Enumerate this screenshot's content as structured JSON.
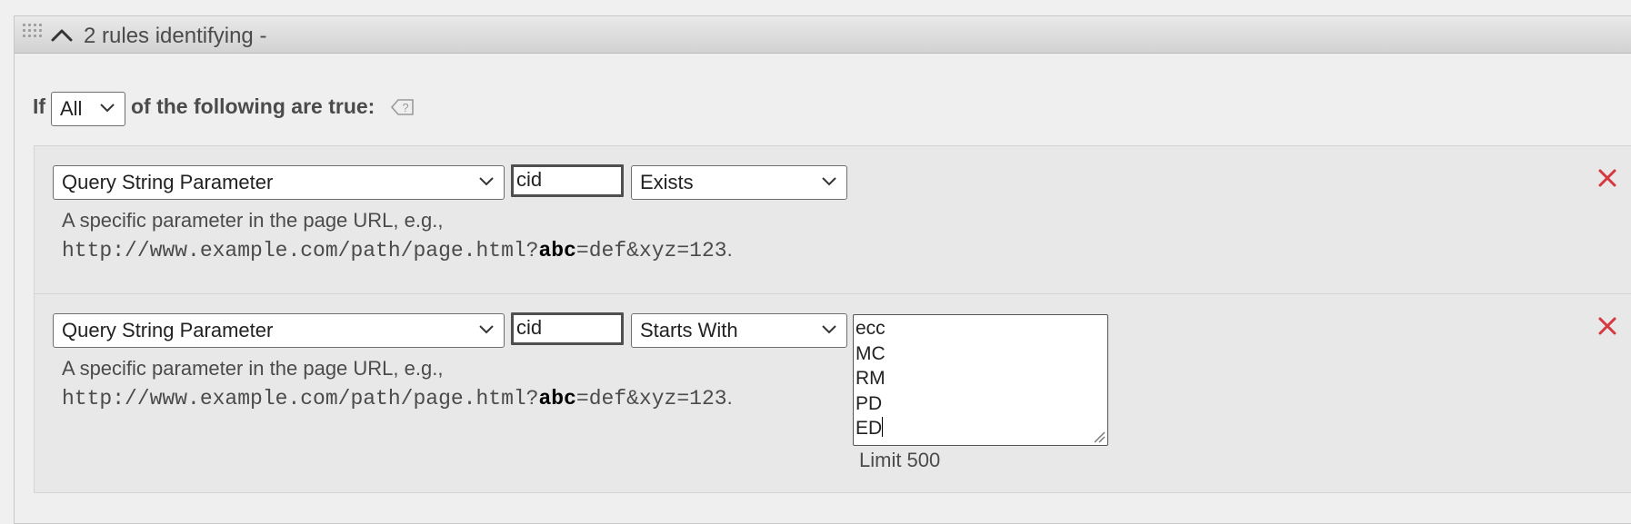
{
  "header": {
    "title": "2 rules identifying -"
  },
  "condition": {
    "if_label": "If",
    "match_value": "All",
    "suffix": "of the following are true:"
  },
  "rules": [
    {
      "type_value": "Query String Parameter",
      "param_value": "cid",
      "operator_value": "Exists",
      "description": "A specific parameter in the page URL, e.g.,",
      "example_prefix": "http://www.example.com/path/page.html?",
      "example_bold": "abc",
      "example_suffix": "=def&xyz=123",
      "example_end": "."
    },
    {
      "type_value": "Query String Parameter",
      "param_value": "cid",
      "operator_value": "Starts With",
      "description": "A specific parameter in the page URL, e.g.,",
      "example_prefix": "http://www.example.com/path/page.html?",
      "example_bold": "abc",
      "example_suffix": "=def&xyz=123",
      "example_end": ".",
      "values": [
        "ecc",
        "MC",
        "RM",
        "PD",
        "ED"
      ],
      "limit_text": "Limit 500"
    }
  ],
  "colors": {
    "remove": "#d7373f",
    "header_gradient_top": "#e9e9e9",
    "header_gradient_bottom": "#d2d2d2"
  },
  "icons": {
    "grip": "drag-handle-icon",
    "chevron": "chevron-up-icon",
    "tag": "tag-help-icon",
    "remove": "close-icon"
  }
}
